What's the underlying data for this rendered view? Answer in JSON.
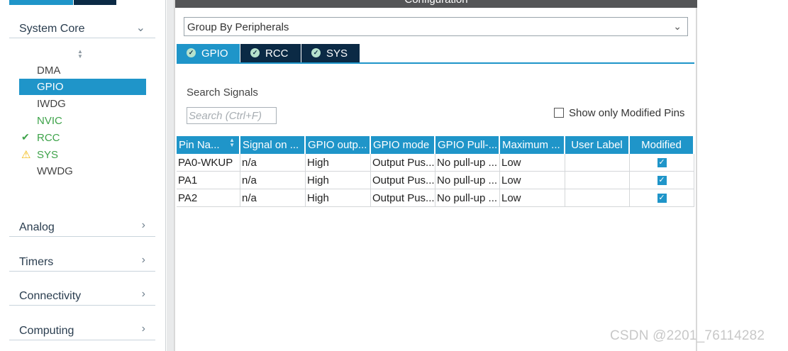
{
  "sidebar": {
    "sections": [
      {
        "label": "System Core",
        "expanded": true
      },
      {
        "label": "Analog",
        "expanded": false
      },
      {
        "label": "Timers",
        "expanded": false
      },
      {
        "label": "Connectivity",
        "expanded": false
      },
      {
        "label": "Computing",
        "expanded": false
      }
    ],
    "core_items": [
      {
        "label": "DMA",
        "status": "none",
        "selected": false
      },
      {
        "label": "GPIO",
        "status": "none",
        "selected": true
      },
      {
        "label": "IWDG",
        "status": "none",
        "selected": false
      },
      {
        "label": "NVIC",
        "status": "none",
        "selected": false
      },
      {
        "label": "RCC",
        "status": "ok",
        "selected": false
      },
      {
        "label": "SYS",
        "status": "warning",
        "selected": false
      },
      {
        "label": "WWDG",
        "status": "none",
        "selected": false
      }
    ]
  },
  "config": {
    "title": "Configuration",
    "group_by": "Group By Peripherals",
    "tabs": [
      {
        "label": "GPIO",
        "active": true
      },
      {
        "label": "RCC",
        "active": false
      },
      {
        "label": "SYS",
        "active": false
      }
    ],
    "search_label": "Search Signals",
    "search_placeholder": "Search (Ctrl+F)",
    "show_modified_label": "Show only Modified Pins",
    "show_modified_checked": false,
    "table": {
      "headers": [
        "Pin Na...",
        "Signal on ...",
        "GPIO outp...",
        "GPIO mode",
        "GPIO Pull-...",
        "Maximum ...",
        "User Label",
        "Modified"
      ],
      "rows": [
        {
          "pin": "PA0-WKUP",
          "signal": "n/a",
          "output": "High",
          "mode": "Output Pus...",
          "pull": "No pull-up ...",
          "max": "Low",
          "user_label": "",
          "modified": true
        },
        {
          "pin": "PA1",
          "signal": "n/a",
          "output": "High",
          "mode": "Output Pus...",
          "pull": "No pull-up ...",
          "max": "Low",
          "user_label": "",
          "modified": true
        },
        {
          "pin": "PA2",
          "signal": "n/a",
          "output": "High",
          "mode": "Output Pus...",
          "pull": "No pull-up ...",
          "max": "Low",
          "user_label": "",
          "modified": true
        }
      ]
    }
  },
  "watermark": "CSDN @2201_76114282",
  "icons": {
    "expanded_chevron": "chevron-down-icon",
    "collapsed_chevron": "chevron-right-icon",
    "ok_status": "check-icon",
    "warning_status": "warning-icon",
    "tab_status": "check-circle-icon"
  },
  "colors": {
    "accent": "#1f95c9",
    "dark_tab": "#0b2a45",
    "ok_green": "#3ea34a",
    "warning_yellow": "#f2b705",
    "config_bar": "#545557"
  }
}
